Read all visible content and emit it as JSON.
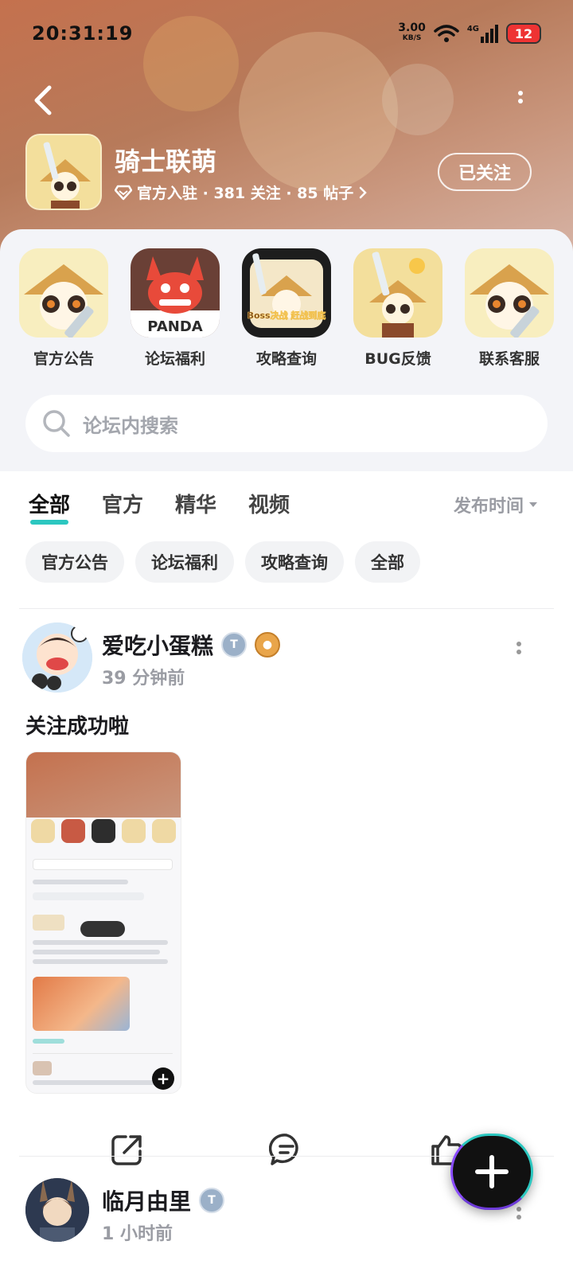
{
  "status_bar": {
    "time": "20:31:19",
    "speed_value": "3.00",
    "speed_unit": "KB/S",
    "network": "4G",
    "battery": "12"
  },
  "forum": {
    "title": "骑士联萌",
    "meta": "官方入驻 · 381 关注 · 85 帖子",
    "follow_label": "已关注"
  },
  "quick_links": [
    {
      "label": "官方公告"
    },
    {
      "label": "论坛福利",
      "icon_text": "PANDA"
    },
    {
      "label": "攻略查询",
      "icon_text": "Boss决战 赶战到底"
    },
    {
      "label": "BUG反馈"
    },
    {
      "label": "联系客服"
    }
  ],
  "search": {
    "placeholder": "论坛内搜索"
  },
  "tabs": [
    {
      "label": "全部",
      "active": true
    },
    {
      "label": "官方"
    },
    {
      "label": "精华"
    },
    {
      "label": "视频"
    }
  ],
  "sort_label": "发布时间",
  "chips": [
    "官方公告",
    "论坛福利",
    "攻略查询",
    "全部"
  ],
  "posts": [
    {
      "author": "爱吃小蛋糕",
      "time": "39 分钟前",
      "title": "关注成功啦"
    },
    {
      "author": "临月由里",
      "time": "1 小时前"
    }
  ],
  "colors": {
    "accent": "#2cc7c0",
    "header": "#c4714e",
    "muted": "#9a9ca3"
  }
}
